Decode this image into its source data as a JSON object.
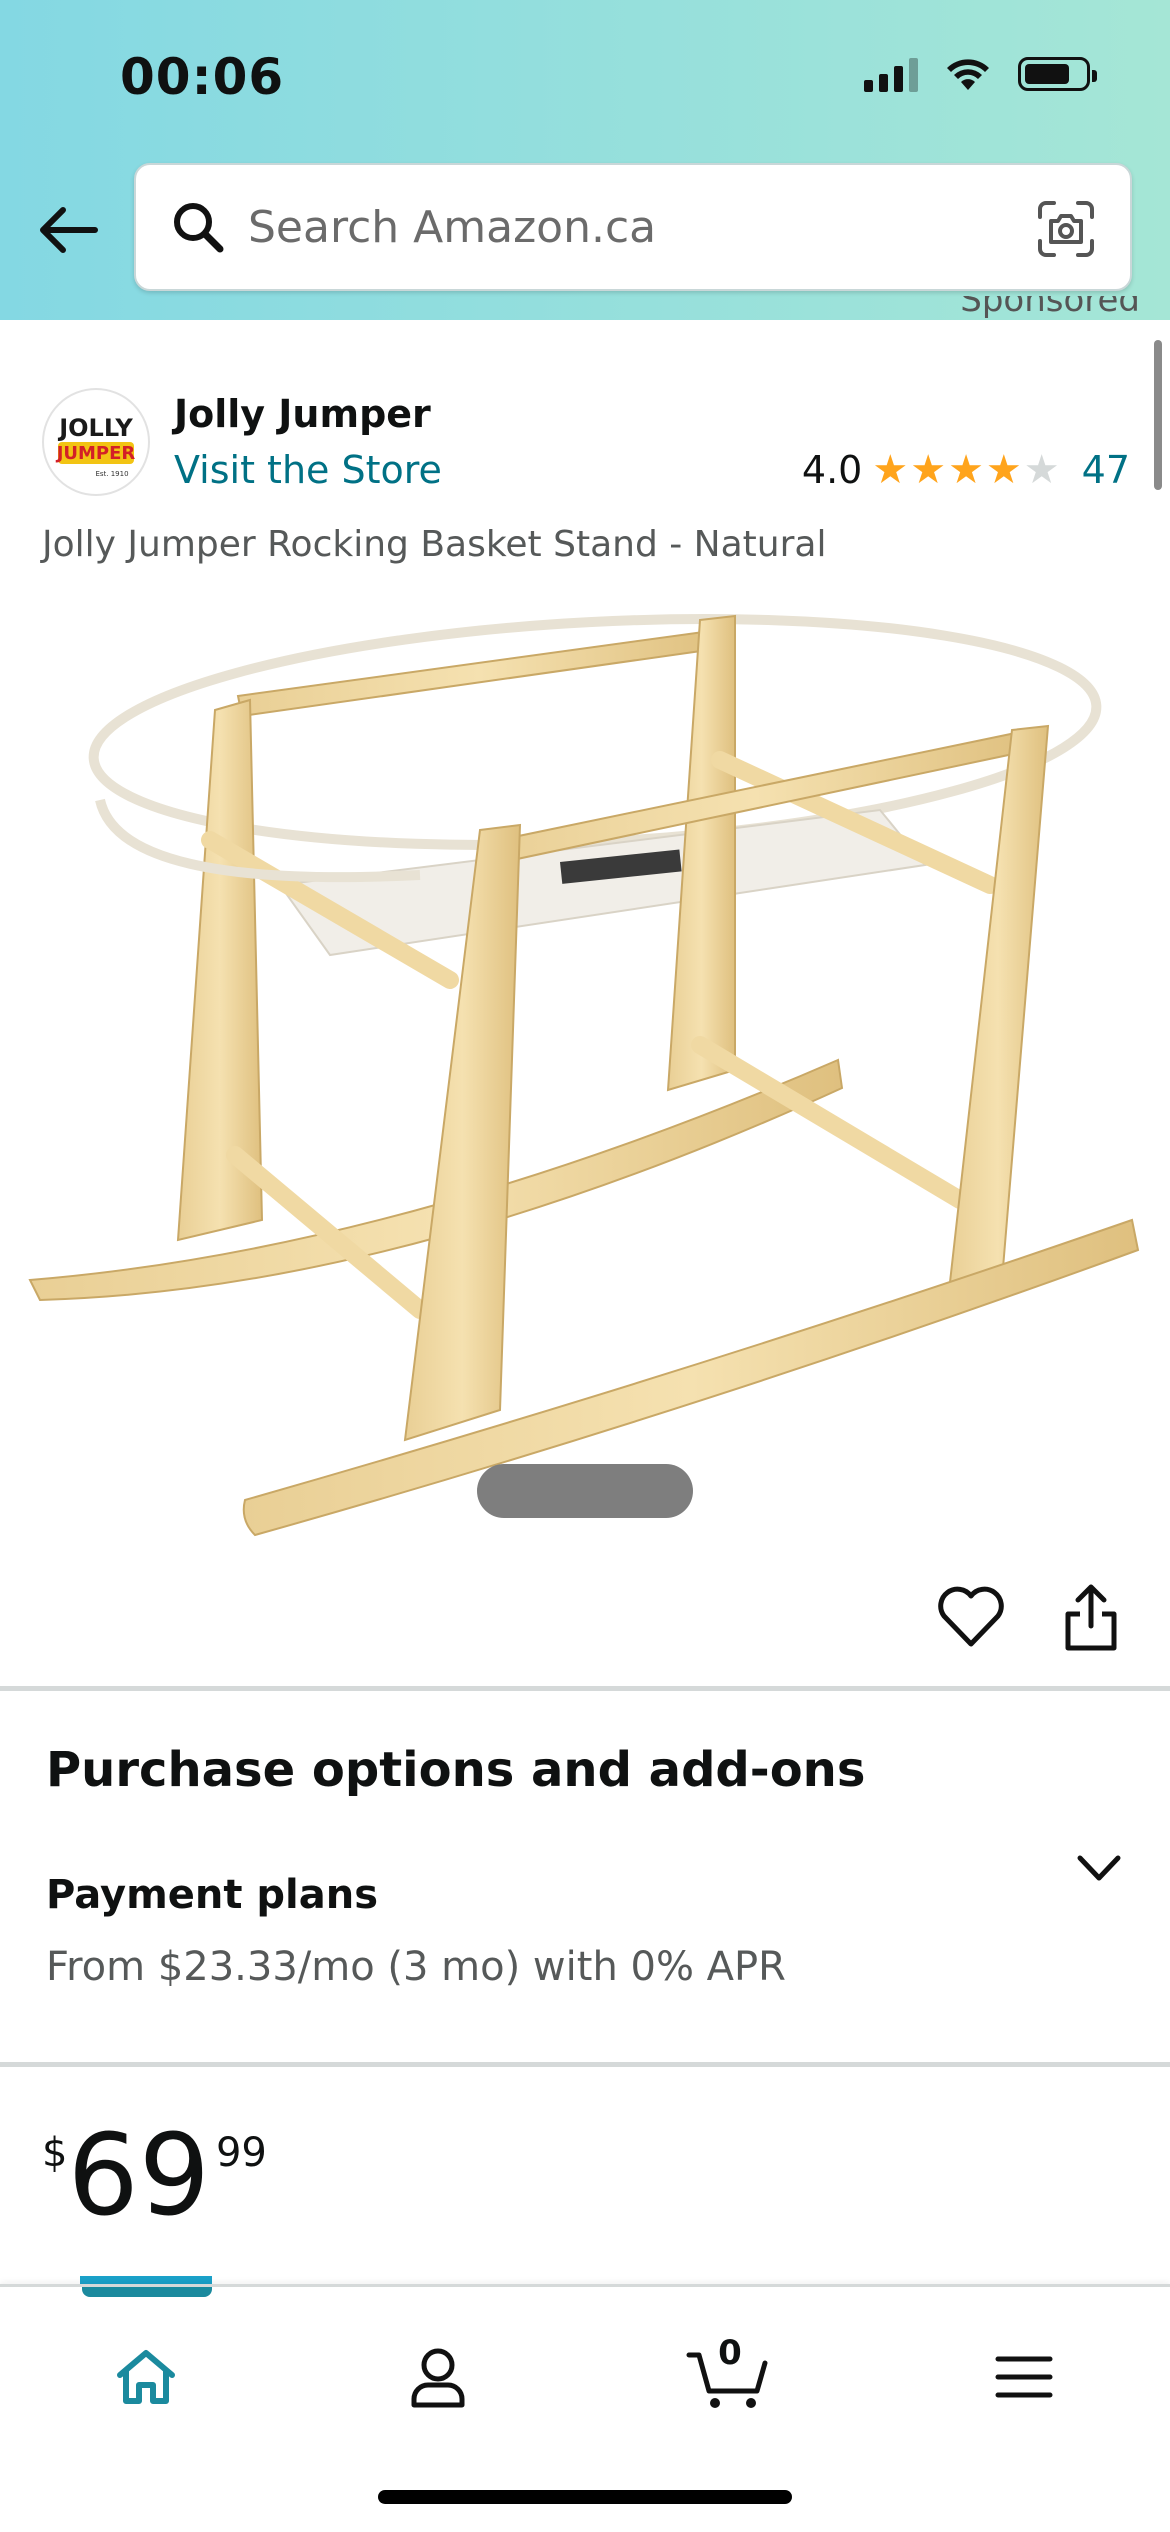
{
  "status_bar": {
    "time": "00:06"
  },
  "search": {
    "placeholder": "Search Amazon.ca"
  },
  "sponsored_label": "Sponsored",
  "brand": {
    "name": "Jolly Jumper",
    "visit_store": "Visit the Store",
    "logo_text_top": "JOLLY",
    "logo_text_bottom": "JUMPER",
    "logo_caption": "Est. 1910"
  },
  "rating": {
    "value": "4.0",
    "stars_filled": 4,
    "stars_total": 5,
    "count": "47",
    "star_color": "#ffa41c"
  },
  "product": {
    "title": "Jolly Jumper Rocking Basket Stand - Natural"
  },
  "purchase_options": {
    "heading": "Purchase options and add-ons",
    "payment_label": "Payment plans",
    "payment_detail": "From $23.33/mo (3 mo) with 0% APR"
  },
  "price": {
    "currency": "$",
    "whole": "69",
    "fraction": "99"
  },
  "bottom_nav": {
    "items": [
      {
        "icon": "home-icon",
        "active": true
      },
      {
        "icon": "account-icon",
        "active": false
      },
      {
        "icon": "cart-icon",
        "active": false,
        "count": "0"
      },
      {
        "icon": "menu-icon",
        "active": false
      }
    ],
    "active_color": "#1b8a9e"
  },
  "colors": {
    "link": "#007185",
    "header_start": "#84d8e3",
    "header_end": "#a5e6d6"
  }
}
